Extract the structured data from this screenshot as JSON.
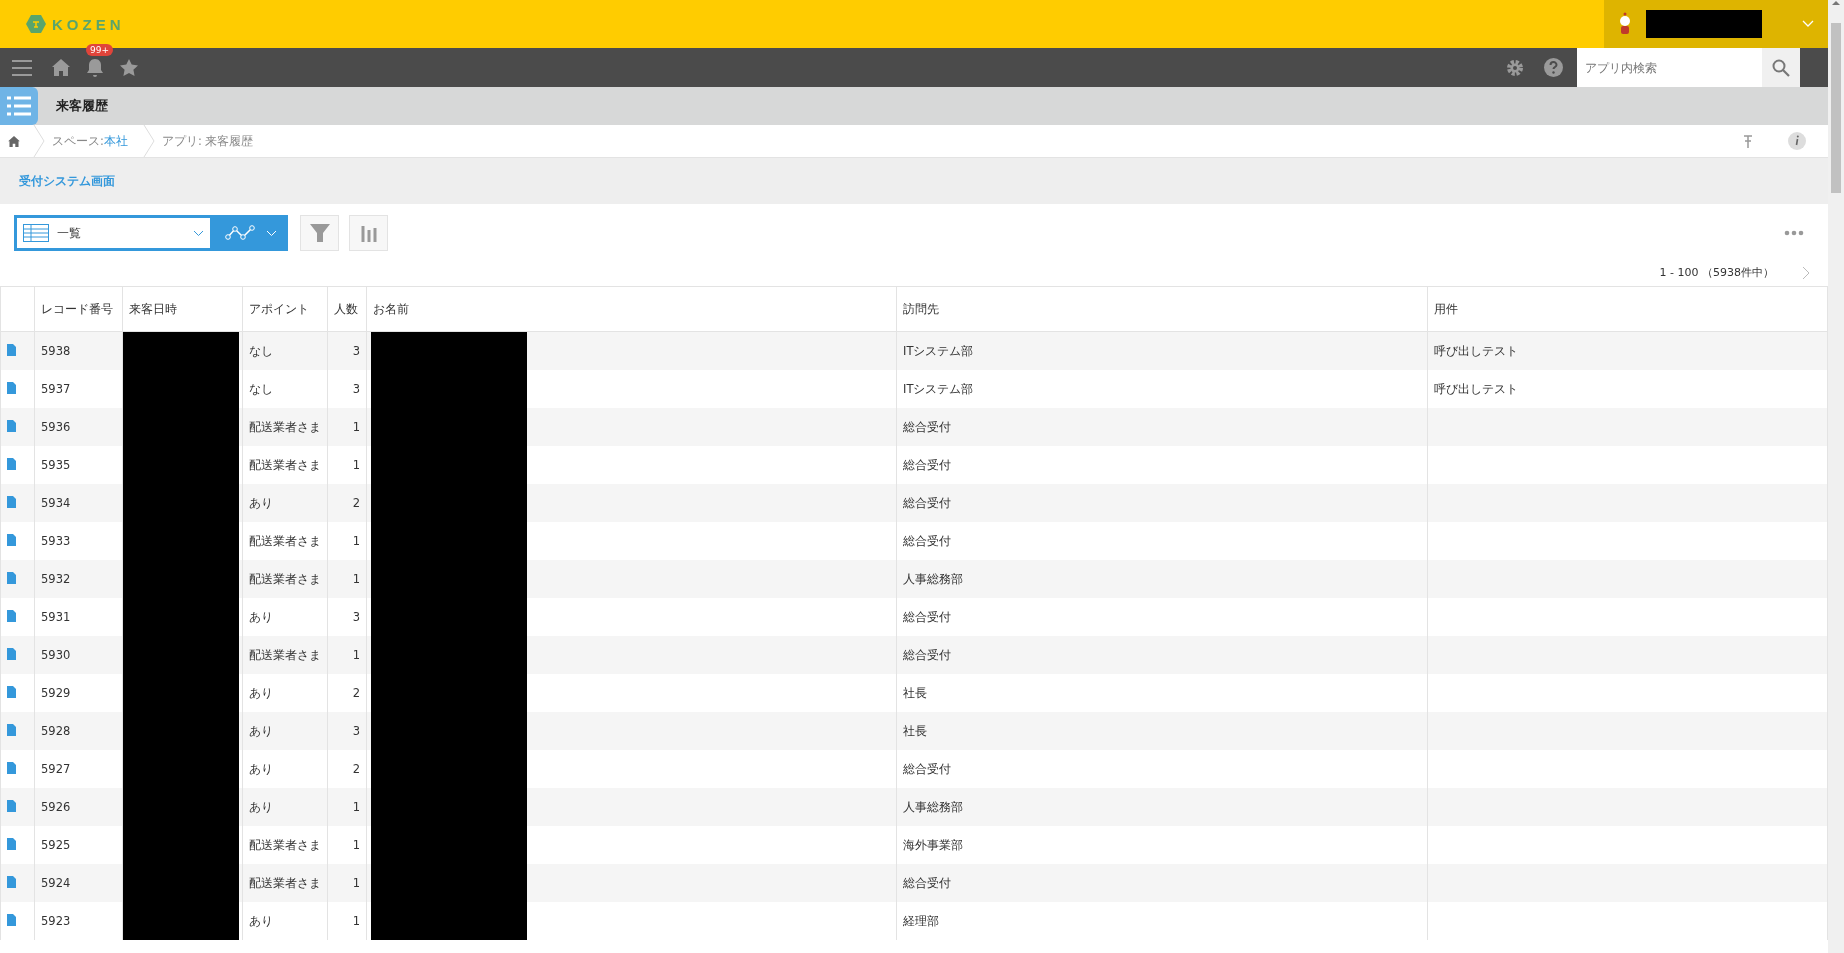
{
  "header": {
    "logo": "KOZEN"
  },
  "nav": {
    "notification_badge": "99+",
    "search": {
      "placeholder": "アプリ内検索"
    }
  },
  "app": {
    "title": "来客履歴"
  },
  "breadcrumb": {
    "space_label": "スペース: ",
    "space_link": "本社",
    "app_label": "アプリ: 来客履歴"
  },
  "page_link": "受付システム画面",
  "view_select": {
    "value": "一覧"
  },
  "pagination": "1 - 100 （5938件中）",
  "table": {
    "columns": [
      "",
      "レコード番号",
      "来客日時",
      "アポイント",
      "人数",
      "お名前",
      "訪問先",
      "用件"
    ],
    "rows": [
      {
        "id": "5938",
        "appointment": "なし",
        "count": "3",
        "destination": "ITシステム部",
        "purpose": "呼び出しテスト"
      },
      {
        "id": "5937",
        "appointment": "なし",
        "count": "3",
        "destination": "ITシステム部",
        "purpose": "呼び出しテスト"
      },
      {
        "id": "5936",
        "appointment": "配送業者さま",
        "count": "1",
        "destination": "総合受付"
      },
      {
        "id": "5935",
        "appointment": "配送業者さま",
        "count": "1",
        "destination": "総合受付"
      },
      {
        "id": "5934",
        "appointment": "あり",
        "count": "2",
        "destination": "総合受付"
      },
      {
        "id": "5933",
        "appointment": "配送業者さま",
        "count": "1",
        "destination": "総合受付"
      },
      {
        "id": "5932",
        "appointment": "配送業者さま",
        "count": "1",
        "destination": "人事総務部"
      },
      {
        "id": "5931",
        "appointment": "あり",
        "count": "3",
        "destination": "総合受付"
      },
      {
        "id": "5930",
        "appointment": "配送業者さま",
        "count": "1",
        "destination": "総合受付"
      },
      {
        "id": "5929",
        "appointment": "あり",
        "count": "2",
        "destination": "社長"
      },
      {
        "id": "5928",
        "appointment": "あり",
        "count": "3",
        "destination": "社長"
      },
      {
        "id": "5927",
        "appointment": "あり",
        "count": "2",
        "destination": "総合受付"
      },
      {
        "id": "5926",
        "appointment": "あり",
        "count": "1",
        "destination": "人事総務部"
      },
      {
        "id": "5925",
        "appointment": "配送業者さま",
        "count": "1",
        "destination": "海外事業部"
      },
      {
        "id": "5924",
        "appointment": "配送業者さま",
        "count": "1",
        "destination": "総合受付"
      },
      {
        "id": "5923",
        "appointment": "あり",
        "count": "1",
        "destination": "経理部"
      }
    ]
  }
}
